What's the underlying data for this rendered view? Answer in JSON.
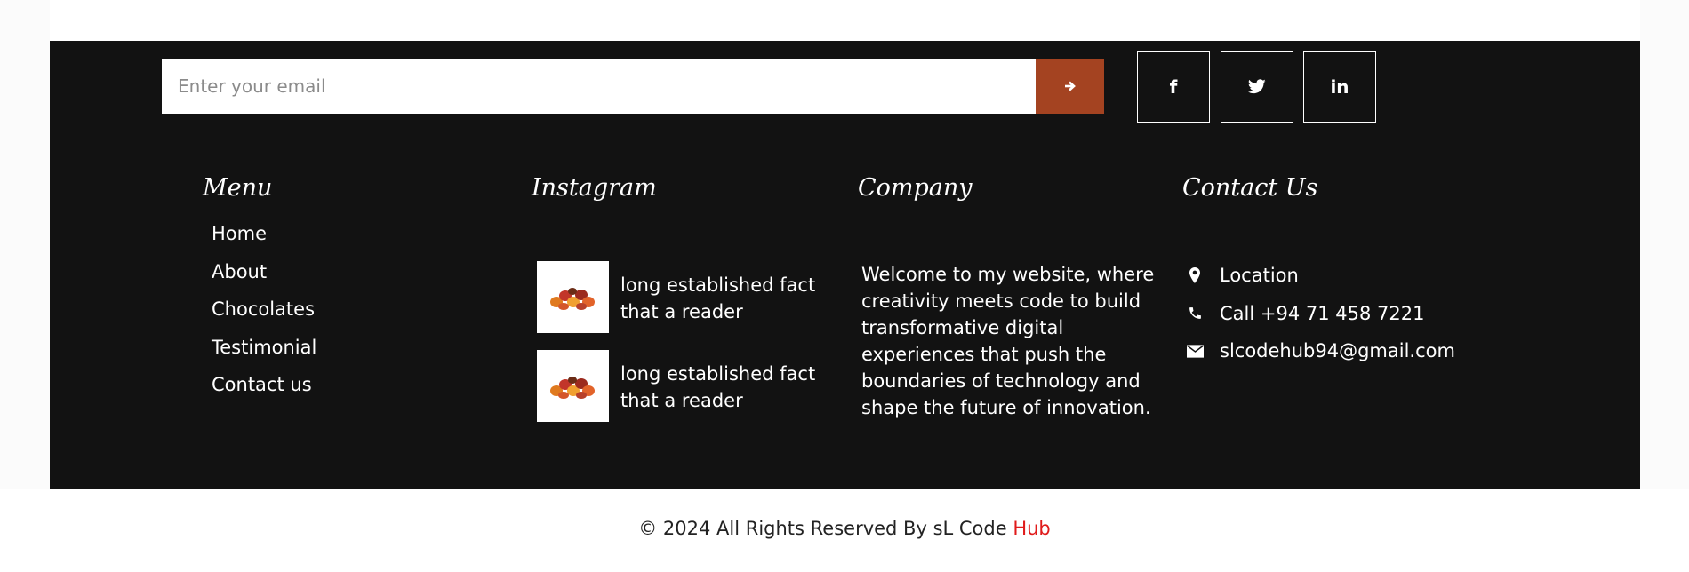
{
  "newsletter": {
    "placeholder": "Enter your email",
    "submit_icon": "arrow-right-icon"
  },
  "social": [
    {
      "icon": "facebook-icon",
      "glyph": "f"
    },
    {
      "icon": "twitter-icon"
    },
    {
      "icon": "linkedin-icon",
      "glyph": "in"
    }
  ],
  "menu": {
    "title": "Menu",
    "items": [
      "Home",
      "About",
      "Chocolates",
      "Testimonial",
      "Contact us"
    ]
  },
  "instagram": {
    "title": "Instagram",
    "posts": [
      {
        "text": "long established fact that a reader"
      },
      {
        "text": "long established fact that a reader"
      }
    ]
  },
  "company": {
    "title": "Company",
    "text": "Welcome to my website, where creativity meets code to build transformative digital experiences that push the boundaries of technology and shape the future of innovation."
  },
  "contact": {
    "title": "Contact Us",
    "items": [
      {
        "icon": "map-marker-icon",
        "text": "Location"
      },
      {
        "icon": "phone-icon",
        "text": "Call +94 71 458 7221"
      },
      {
        "icon": "envelope-icon",
        "text": "slcodehub94@gmail.com"
      }
    ]
  },
  "copyright": {
    "prefix": "© 2024 All Rights Reserved By sL Code ",
    "highlight": "Hub"
  },
  "colors": {
    "footer_bg": "#121212",
    "accent": "#a44321",
    "highlight": "#e01b1b"
  }
}
